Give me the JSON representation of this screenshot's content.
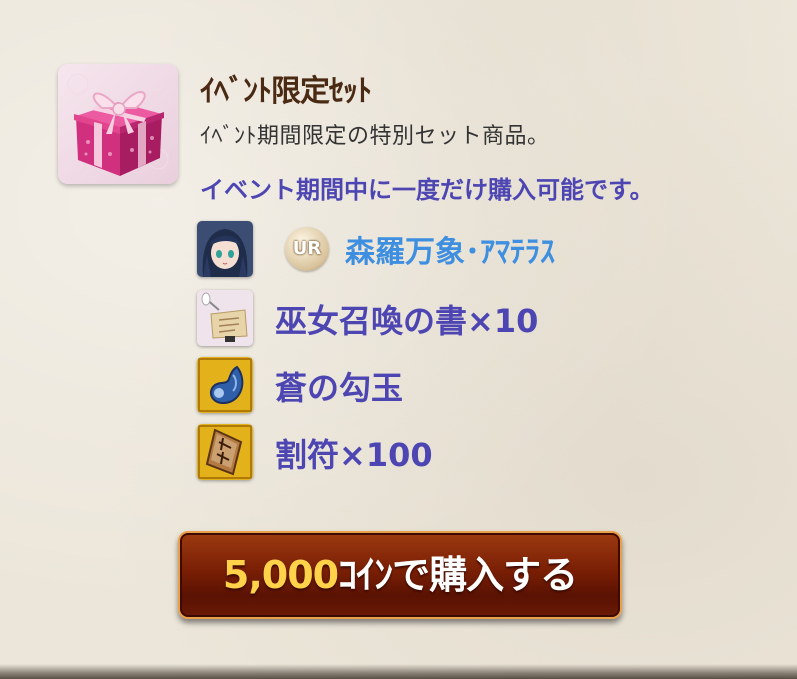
{
  "set": {
    "title": "ｲﾍﾞﾝﾄ限定ｾｯﾄ",
    "description": "ｲﾍﾞﾝﾄ期間限定の特別セット商品。",
    "notice": "イベント期間中に一度だけ購入可能です。"
  },
  "items": [
    {
      "name": "森羅万象･ｱﾏﾃﾗｽ",
      "rarity": "UR",
      "icon": "character-portrait-icon"
    },
    {
      "name": "巫女召喚の書×10",
      "icon": "summon-scroll-icon"
    },
    {
      "name": "蒼の勾玉",
      "icon": "blue-magatama-icon"
    },
    {
      "name": "割符×100",
      "icon": "tally-plaque-icon"
    }
  ],
  "buy_button": {
    "price": "5,000",
    "label": "ｺｲﾝで購入する"
  },
  "colors": {
    "item_text": "#4d46b2",
    "character_text": "#3f8fe0",
    "title_text": "#4a2a12",
    "button_bg": "#7a1f05",
    "price_text": "#ffd24a"
  }
}
